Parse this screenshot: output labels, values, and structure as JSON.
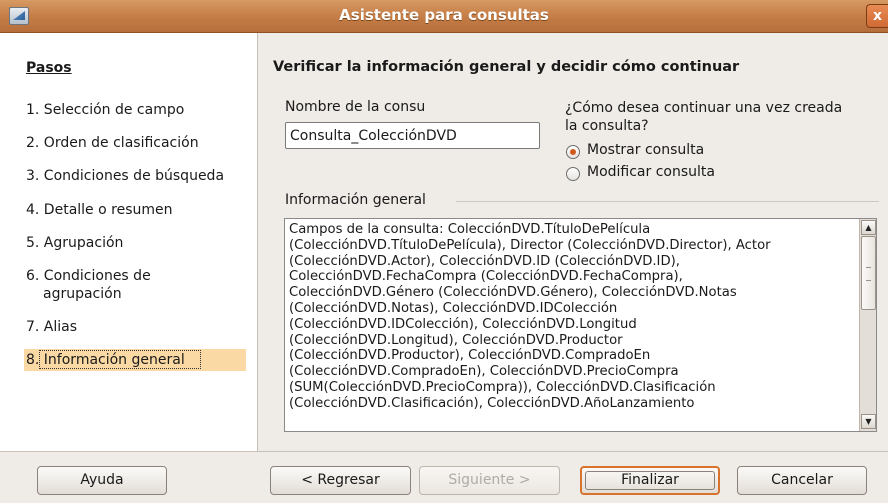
{
  "window": {
    "title": "Asistente para consultas",
    "close_label": "x"
  },
  "steps": {
    "heading": "Pasos",
    "items": [
      "1. Selección de campo",
      "2. Orden de clasificación",
      "3. Condiciones de búsqueda",
      "4. Detalle o resumen",
      "5. Agrupación",
      "6. Condiciones de agrupación",
      "7. Alias",
      "8. Información general"
    ],
    "group_line1": "6. Condiciones de",
    "group_line2": "agrupación",
    "active_index": 7
  },
  "main": {
    "heading": "Verificar la información general y decidir cómo continuar",
    "name_label": "Nombre de la consu",
    "name_value": "Consulta_ColecciónDVD",
    "continue_label_line1": "¿Cómo desea continuar una vez creada",
    "continue_label_line2": "la consulta?",
    "option_show": "Mostrar consulta",
    "option_modify": "Modificar consulta",
    "selected_option": "show",
    "info_label": "Información general",
    "info_text": "Campos de la consulta: ColecciónDVD.TítuloDePelícula\n(ColecciónDVD.TítuloDePelícula), Director (ColecciónDVD.Director), Actor\n(ColecciónDVD.Actor), ColecciónDVD.ID (ColecciónDVD.ID),\nColecciónDVD.FechaCompra (ColecciónDVD.FechaCompra),\nColecciónDVD.Género (ColecciónDVD.Género), ColecciónDVD.Notas\n(ColecciónDVD.Notas), ColecciónDVD.IDColección\n(ColecciónDVD.IDColección), ColecciónDVD.Longitud\n(ColecciónDVD.Longitud), ColecciónDVD.Productor\n(ColecciónDVD.Productor), ColecciónDVD.CompradoEn\n(ColecciónDVD.CompradoEn), ColecciónDVD.PrecioCompra\n(SUM(ColecciónDVD.PrecioCompra)), ColecciónDVD.Clasificación\n(ColecciónDVD.Clasificación), ColecciónDVD.AñoLanzamiento"
  },
  "buttons": {
    "help": "Ayuda",
    "back": "< Regresar",
    "next": "Siguiente >",
    "finish": "Finalizar",
    "cancel": "Cancelar"
  },
  "colors": {
    "titlebar": "#c8804a",
    "active_step": "#fad9a5",
    "default_button_border": "#d8732e",
    "radio_dot": "#d05a1e"
  },
  "icons": [
    "app-icon",
    "close-icon",
    "radio-selected-icon",
    "radio-unselected-icon",
    "scroll-up-icon",
    "scroll-down-icon"
  ]
}
